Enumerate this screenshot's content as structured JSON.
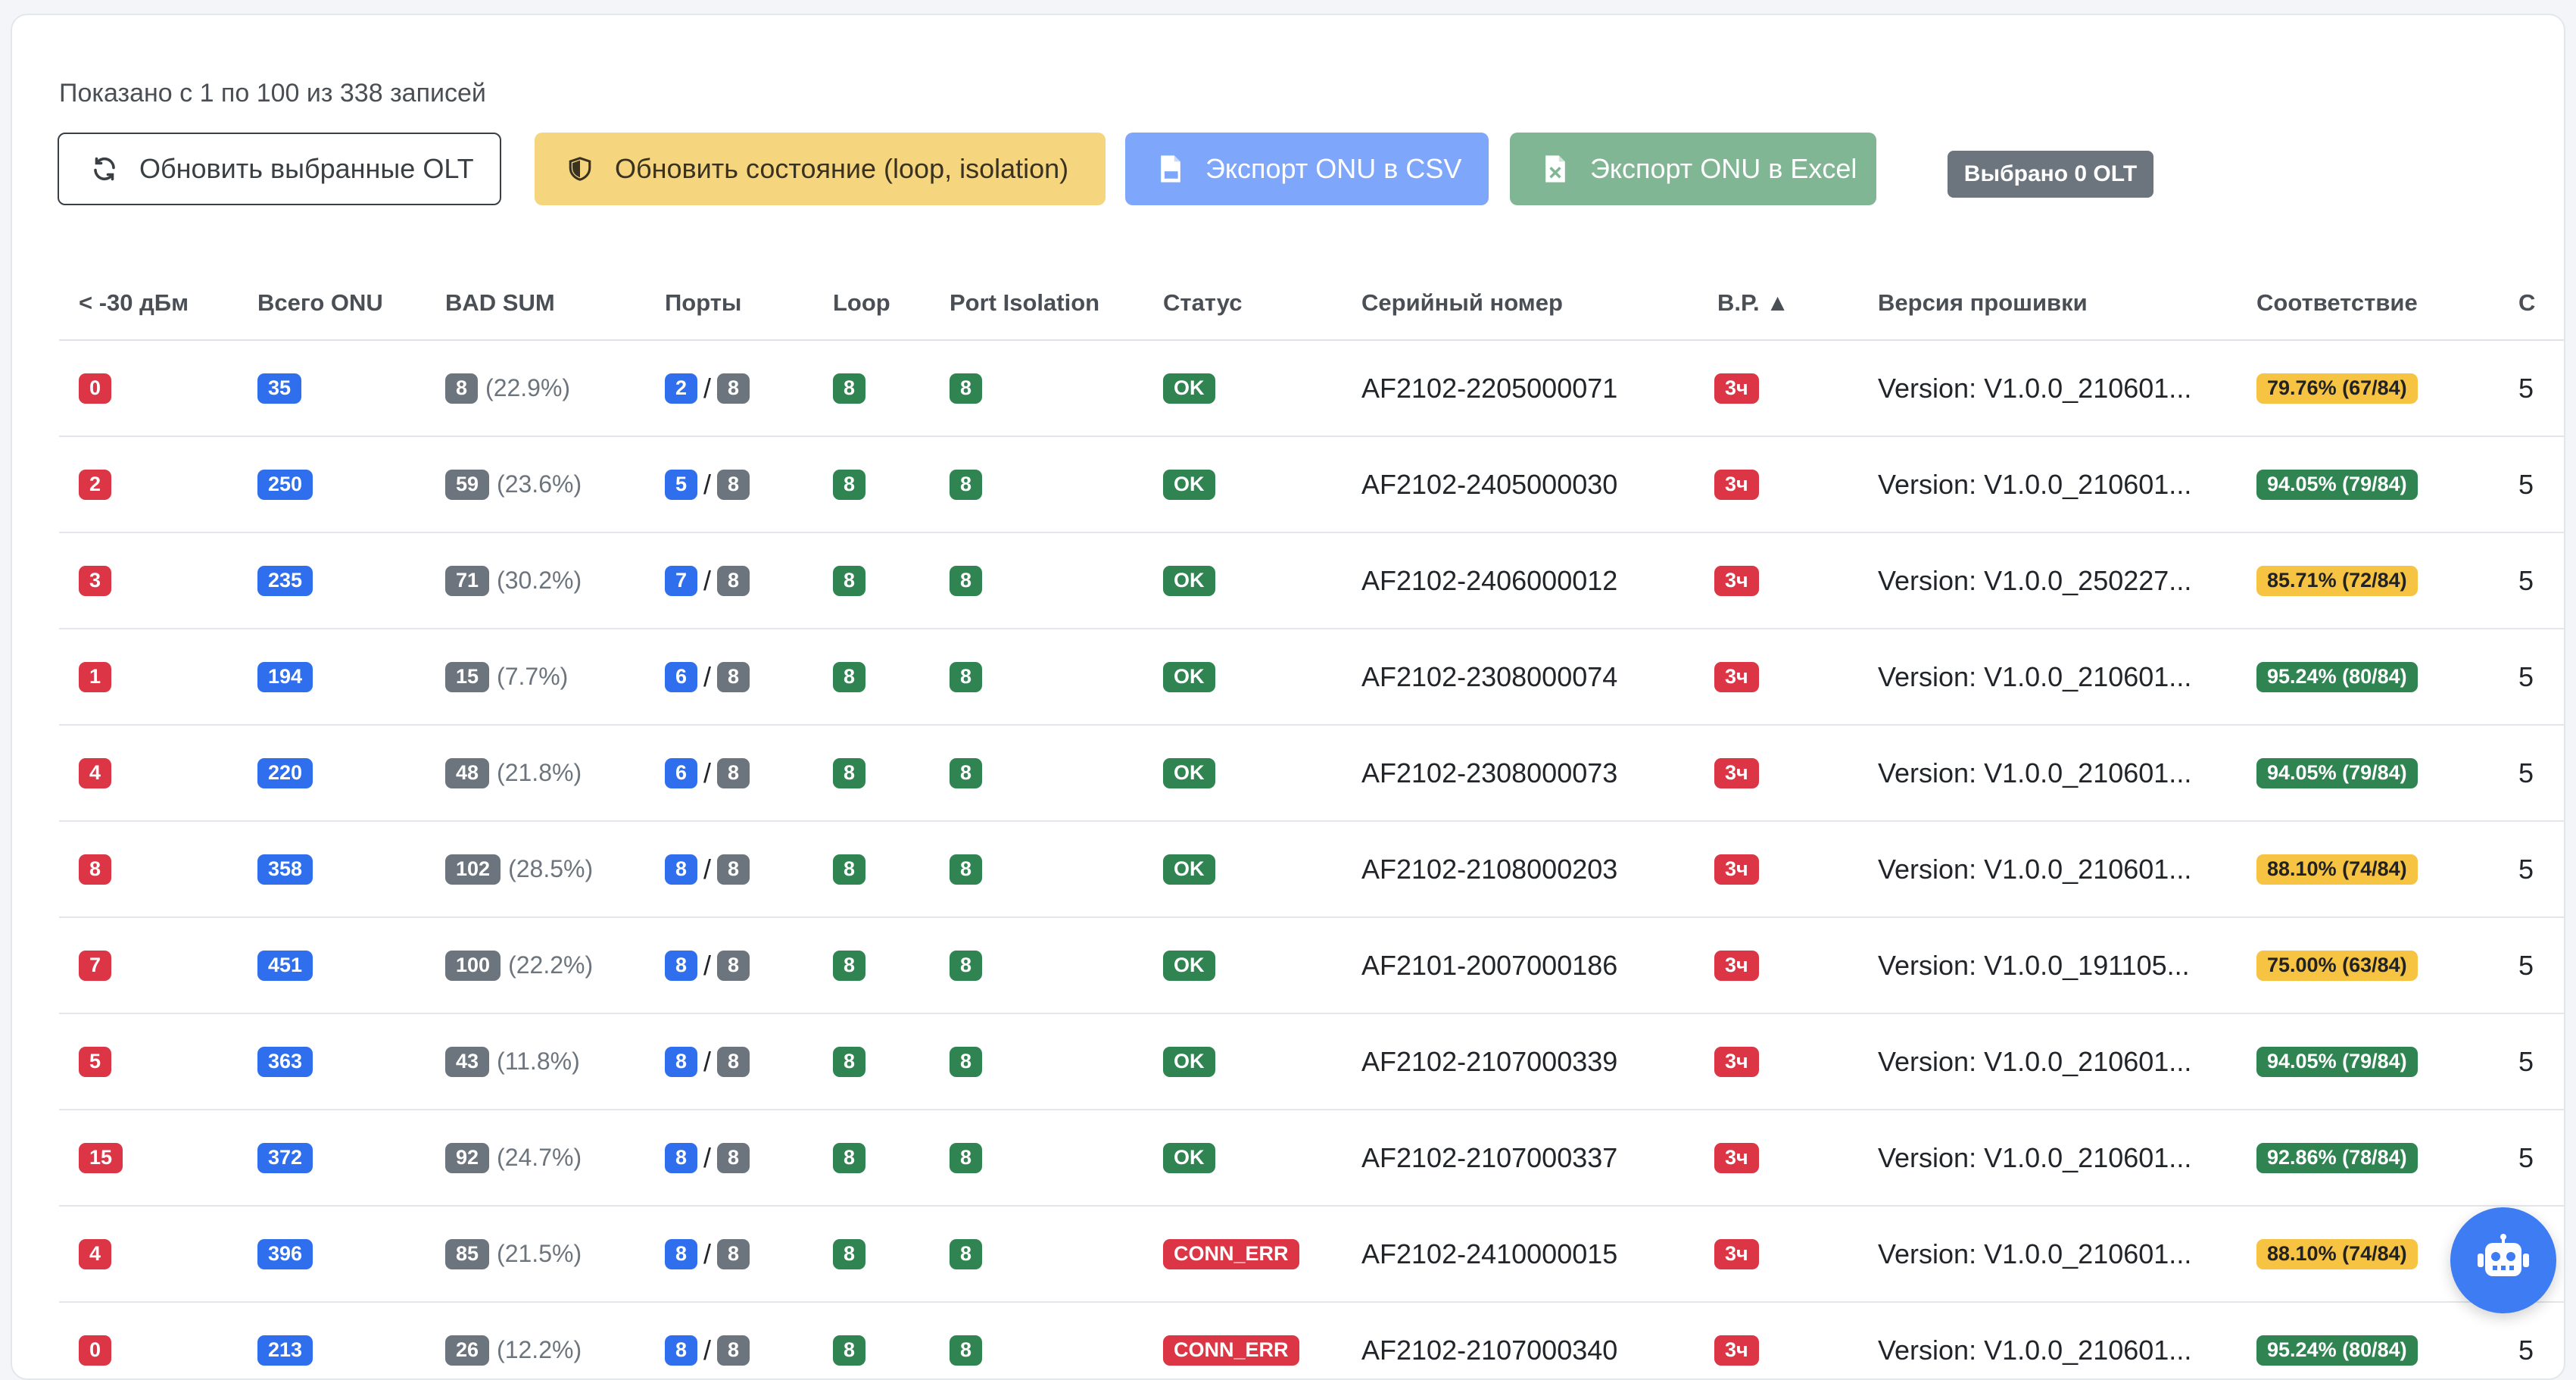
{
  "summary": "Показано с 1 по 100 из 338 записей",
  "toolbar": {
    "refresh_label": "Обновить выбранные OLT",
    "update_state_label": "Обновить состояние (loop, isolation)",
    "export_csv_label": "Экспорт ONU в CSV",
    "export_excel_label": "Экспорт ONU в Excel",
    "selected_label": "Выбрано 0 OLT"
  },
  "columns": {
    "low_signal": "< -30 дБм",
    "total_onu": "Всего ONU",
    "bad_sum": "BAD SUM",
    "ports": "Порты",
    "loop": "Loop",
    "port_isolation": "Port Isolation",
    "status": "Статус",
    "serial": "Серийный номер",
    "vr": "В.Р. ▲",
    "firmware": "Версия прошивки",
    "compliance": "Соответствие",
    "last": "С"
  },
  "colors": {
    "red": "#dc3545",
    "blue": "#2f6fed",
    "gray": "#6c757d",
    "green": "#2f8451",
    "yellow": "#f6c343",
    "warning_button": "#f6d57f",
    "primary_button": "#7ea6fb",
    "success_button": "#80b694"
  },
  "rows": [
    {
      "low": "0",
      "total": "35",
      "bad": "8",
      "bad_pct": "(22.9%)",
      "ports_up": "2",
      "ports_total": "8",
      "loop": "8",
      "iso": "8",
      "status": "OK",
      "status_ok": true,
      "serial": "AF2102-2205000071",
      "vr": "3ч",
      "fw": "Version: V1.0.0_210601...",
      "comp": "79.76% (67/84)",
      "comp_level": "warn",
      "last": "5"
    },
    {
      "low": "2",
      "total": "250",
      "bad": "59",
      "bad_pct": "(23.6%)",
      "ports_up": "5",
      "ports_total": "8",
      "loop": "8",
      "iso": "8",
      "status": "OK",
      "status_ok": true,
      "serial": "AF2102-2405000030",
      "vr": "3ч",
      "fw": "Version: V1.0.0_210601...",
      "comp": "94.05% (79/84)",
      "comp_level": "good",
      "last": "5"
    },
    {
      "low": "3",
      "total": "235",
      "bad": "71",
      "bad_pct": "(30.2%)",
      "ports_up": "7",
      "ports_total": "8",
      "loop": "8",
      "iso": "8",
      "status": "OK",
      "status_ok": true,
      "serial": "AF2102-2406000012",
      "vr": "3ч",
      "fw": "Version: V1.0.0_250227...",
      "comp": "85.71% (72/84)",
      "comp_level": "warn",
      "last": "5"
    },
    {
      "low": "1",
      "total": "194",
      "bad": "15",
      "bad_pct": "(7.7%)",
      "ports_up": "6",
      "ports_total": "8",
      "loop": "8",
      "iso": "8",
      "status": "OK",
      "status_ok": true,
      "serial": "AF2102-2308000074",
      "vr": "3ч",
      "fw": "Version: V1.0.0_210601...",
      "comp": "95.24% (80/84)",
      "comp_level": "good",
      "last": "5"
    },
    {
      "low": "4",
      "total": "220",
      "bad": "48",
      "bad_pct": "(21.8%)",
      "ports_up": "6",
      "ports_total": "8",
      "loop": "8",
      "iso": "8",
      "status": "OK",
      "status_ok": true,
      "serial": "AF2102-2308000073",
      "vr": "3ч",
      "fw": "Version: V1.0.0_210601...",
      "comp": "94.05% (79/84)",
      "comp_level": "good",
      "last": "5"
    },
    {
      "low": "8",
      "total": "358",
      "bad": "102",
      "bad_pct": "(28.5%)",
      "ports_up": "8",
      "ports_total": "8",
      "loop": "8",
      "iso": "8",
      "status": "OK",
      "status_ok": true,
      "serial": "AF2102-2108000203",
      "vr": "3ч",
      "fw": "Version: V1.0.0_210601...",
      "comp": "88.10% (74/84)",
      "comp_level": "warn",
      "last": "5"
    },
    {
      "low": "7",
      "total": "451",
      "bad": "100",
      "bad_pct": "(22.2%)",
      "ports_up": "8",
      "ports_total": "8",
      "loop": "8",
      "iso": "8",
      "status": "OK",
      "status_ok": true,
      "serial": "AF2101-2007000186",
      "vr": "3ч",
      "fw": "Version: V1.0.0_191105...",
      "comp": "75.00% (63/84)",
      "comp_level": "warn",
      "last": "5"
    },
    {
      "low": "5",
      "total": "363",
      "bad": "43",
      "bad_pct": "(11.8%)",
      "ports_up": "8",
      "ports_total": "8",
      "loop": "8",
      "iso": "8",
      "status": "OK",
      "status_ok": true,
      "serial": "AF2102-2107000339",
      "vr": "3ч",
      "fw": "Version: V1.0.0_210601...",
      "comp": "94.05% (79/84)",
      "comp_level": "good",
      "last": "5"
    },
    {
      "low": "15",
      "total": "372",
      "bad": "92",
      "bad_pct": "(24.7%)",
      "ports_up": "8",
      "ports_total": "8",
      "loop": "8",
      "iso": "8",
      "status": "OK",
      "status_ok": true,
      "serial": "AF2102-2107000337",
      "vr": "3ч",
      "fw": "Version: V1.0.0_210601...",
      "comp": "92.86% (78/84)",
      "comp_level": "good",
      "last": "5"
    },
    {
      "low": "4",
      "total": "396",
      "bad": "85",
      "bad_pct": "(21.5%)",
      "ports_up": "8",
      "ports_total": "8",
      "loop": "8",
      "iso": "8",
      "status": "CONN_ERR",
      "status_ok": false,
      "serial": "AF2102-2410000015",
      "vr": "3ч",
      "fw": "Version: V1.0.0_210601...",
      "comp": "88.10% (74/84)",
      "comp_level": "warn",
      "last": "5"
    },
    {
      "low": "0",
      "total": "213",
      "bad": "26",
      "bad_pct": "(12.2%)",
      "ports_up": "8",
      "ports_total": "8",
      "loop": "8",
      "iso": "8",
      "status": "CONN_ERR",
      "status_ok": false,
      "serial": "AF2102-2107000340",
      "vr": "3ч",
      "fw": "Version: V1.0.0_210601...",
      "comp": "95.24% (80/84)",
      "comp_level": "good",
      "last": "5"
    }
  ],
  "fab": {
    "icon": "robot-icon"
  }
}
